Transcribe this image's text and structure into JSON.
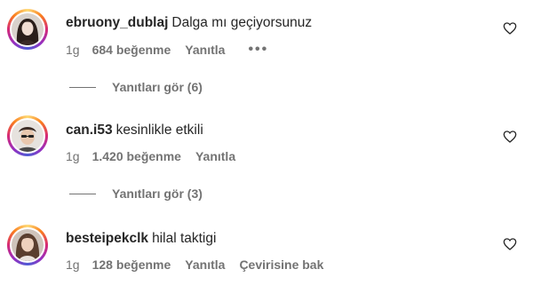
{
  "comments": [
    {
      "username": "ebruony_dublaj",
      "text": "Dalga mı geçiyorsunuz",
      "time": "1g",
      "likes": "684 beğenme",
      "reply": "Yanıtla",
      "more": "•••",
      "view_replies": "Yanıtları gör (6)"
    },
    {
      "username": "can.i53",
      "text": "kesinlikle etkili",
      "time": "1g",
      "likes": "1.420 beğenme",
      "reply": "Yanıtla",
      "view_replies": "Yanıtları gör (3)"
    },
    {
      "username": "besteipekclk",
      "text": "hilal taktigi",
      "time": "1g",
      "likes": "128 beğenme",
      "reply": "Yanıtla",
      "translate": "Çevirisine bak"
    }
  ],
  "icons": {
    "like": "heart-outline-icon",
    "more": "more-horizontal-icon"
  },
  "colors": {
    "text": "#262626",
    "secondary": "#737373",
    "ring_start": "#feda75",
    "ring_end": "#962fbf"
  }
}
